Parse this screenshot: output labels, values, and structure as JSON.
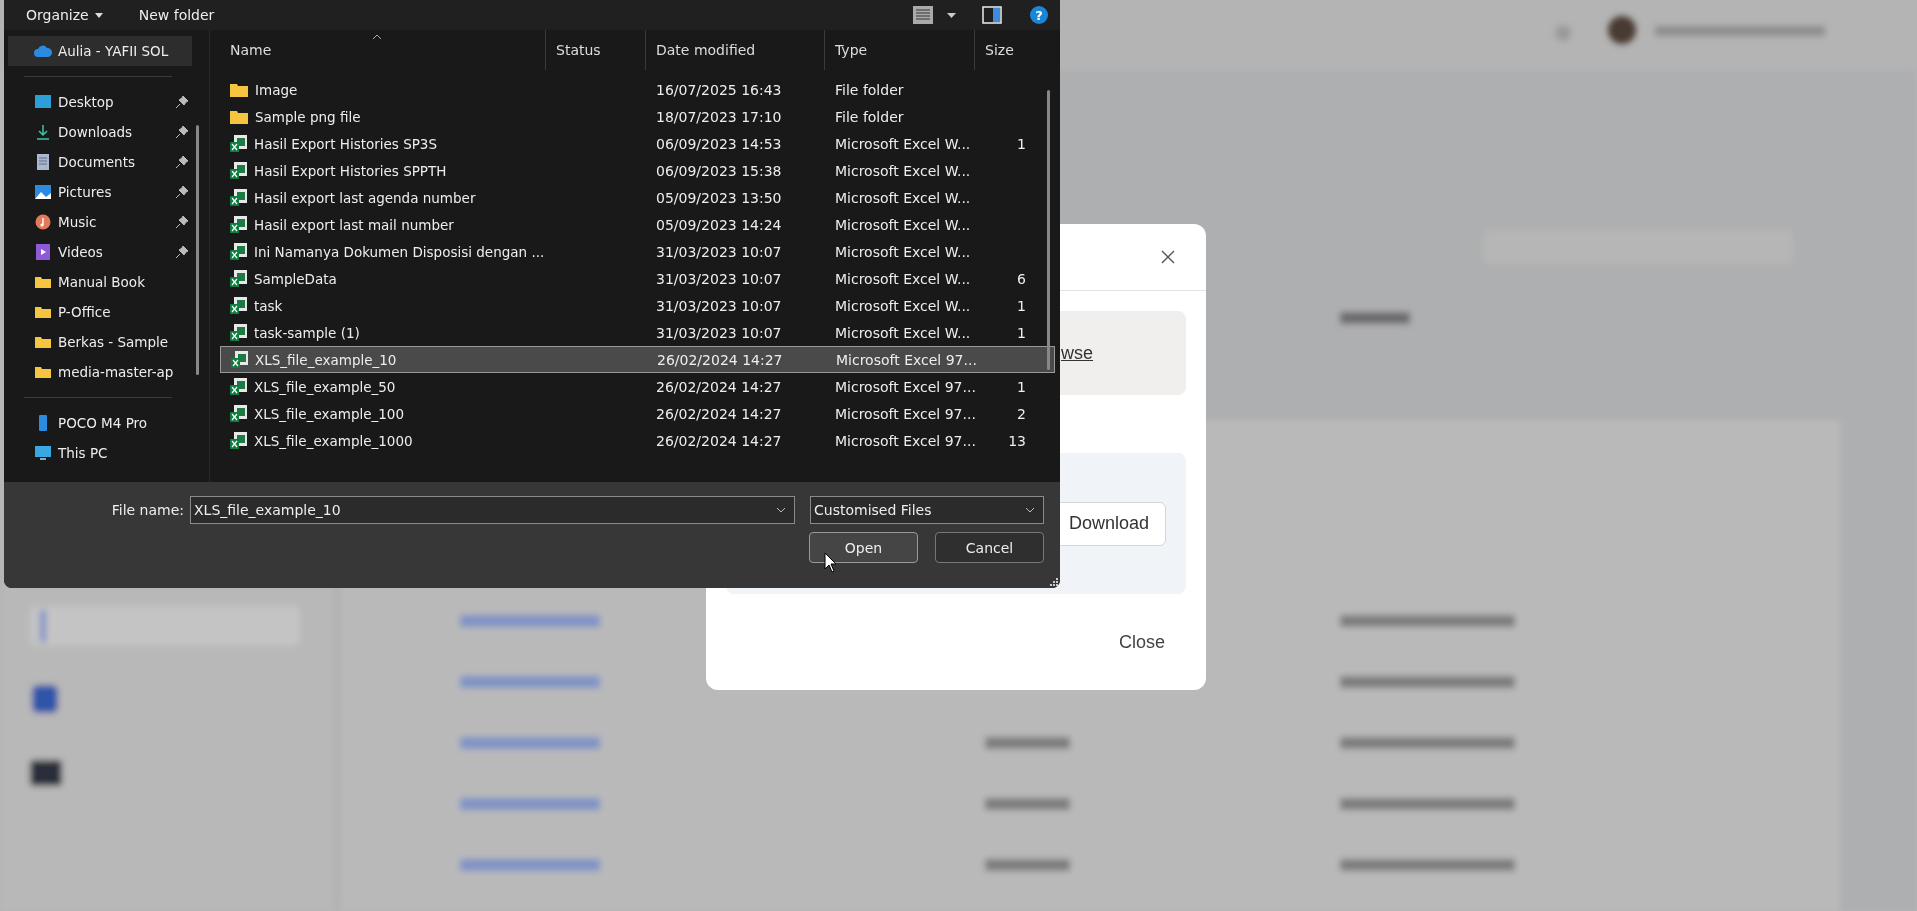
{
  "file_dialog": {
    "toolbar": {
      "organize": "Organize",
      "new_folder": "New folder",
      "help": "?"
    },
    "nav_groups": [
      {
        "items": [
          {
            "label": "Aulia - YAFII SOL",
            "kind": "cloud",
            "pinned": false,
            "selected": true
          }
        ]
      },
      {
        "items": [
          {
            "label": "Desktop",
            "kind": "desktop",
            "pinned": true,
            "selected": false
          },
          {
            "label": "Downloads",
            "kind": "download",
            "pinned": true,
            "selected": false
          },
          {
            "label": "Documents",
            "kind": "document",
            "pinned": true,
            "selected": false
          },
          {
            "label": "Pictures",
            "kind": "picture",
            "pinned": true,
            "selected": false
          },
          {
            "label": "Music",
            "kind": "music",
            "pinned": true,
            "selected": false
          },
          {
            "label": "Videos",
            "kind": "video",
            "pinned": true,
            "selected": false
          },
          {
            "label": "Manual Book",
            "kind": "folder",
            "pinned": false,
            "selected": false
          },
          {
            "label": "P-Office",
            "kind": "folder",
            "pinned": false,
            "selected": false
          },
          {
            "label": "Berkas - Sample",
            "kind": "folder",
            "pinned": false,
            "selected": false
          },
          {
            "label": "media-master-ap",
            "kind": "folder",
            "pinned": false,
            "selected": false
          }
        ]
      },
      {
        "items": [
          {
            "label": "POCO M4 Pro",
            "kind": "phone",
            "pinned": false,
            "selected": false
          },
          {
            "label": "This PC",
            "kind": "pc",
            "pinned": false,
            "selected": false
          }
        ]
      }
    ],
    "columns": [
      "Name",
      "Status",
      "Date modified",
      "Type",
      "Size"
    ],
    "files": [
      {
        "name": "Image",
        "kind": "folder",
        "date": "16/07/2025 16:43",
        "type": "File folder",
        "selected": false
      },
      {
        "name": "Sample png file",
        "kind": "folder",
        "date": "18/07/2023 17:10",
        "type": "File folder",
        "selected": false
      },
      {
        "name": "Hasil Export Histories SP3S",
        "kind": "excel",
        "date": "06/09/2023 14:53",
        "type": "Microsoft Excel W...",
        "size": "1",
        "selected": false
      },
      {
        "name": "Hasil Export Histories SPPTH",
        "kind": "excel",
        "date": "06/09/2023 15:38",
        "type": "Microsoft Excel W...",
        "selected": false
      },
      {
        "name": "Hasil export last agenda number",
        "kind": "excel",
        "date": "05/09/2023 13:50",
        "type": "Microsoft Excel W...",
        "selected": false
      },
      {
        "name": "Hasil export last mail number",
        "kind": "excel",
        "date": "05/09/2023 14:24",
        "type": "Microsoft Excel W...",
        "selected": false
      },
      {
        "name": "Ini Namanya Dokumen Disposisi dengan ...",
        "kind": "excel",
        "date": "31/03/2023 10:07",
        "type": "Microsoft Excel W...",
        "selected": false
      },
      {
        "name": "SampleData",
        "kind": "excel",
        "date": "31/03/2023 10:07",
        "type": "Microsoft Excel W...",
        "size": "6",
        "selected": false
      },
      {
        "name": "task",
        "kind": "excel",
        "date": "31/03/2023 10:07",
        "type": "Microsoft Excel W...",
        "size": "1",
        "selected": false
      },
      {
        "name": "task-sample (1)",
        "kind": "excel",
        "date": "31/03/2023 10:07",
        "type": "Microsoft Excel W...",
        "size": "1",
        "selected": false
      },
      {
        "name": "XLS_file_example_10",
        "kind": "excel",
        "date": "26/02/2024 14:27",
        "type": "Microsoft Excel 97...",
        "selected": true
      },
      {
        "name": "XLS_file_example_50",
        "kind": "excel",
        "date": "26/02/2024 14:27",
        "type": "Microsoft Excel 97...",
        "size": "1",
        "selected": false
      },
      {
        "name": "XLS_file_example_100",
        "kind": "excel",
        "date": "26/02/2024 14:27",
        "type": "Microsoft Excel 97...",
        "size": "2",
        "selected": false
      },
      {
        "name": "XLS_file_example_1000",
        "kind": "excel",
        "date": "26/02/2024 14:27",
        "type": "Microsoft Excel 97...",
        "size": "13",
        "selected": false
      }
    ],
    "file_name_label": "File name:",
    "file_name": "XLS_file_example_10",
    "filter": "Customised Files",
    "buttons": [
      {
        "label": "Open",
        "focused": true
      },
      {
        "label": "Cancel",
        "focused": false
      }
    ]
  },
  "modal": {
    "browse_link": "wse",
    "download_button": "Download",
    "close_button": "Close"
  }
}
